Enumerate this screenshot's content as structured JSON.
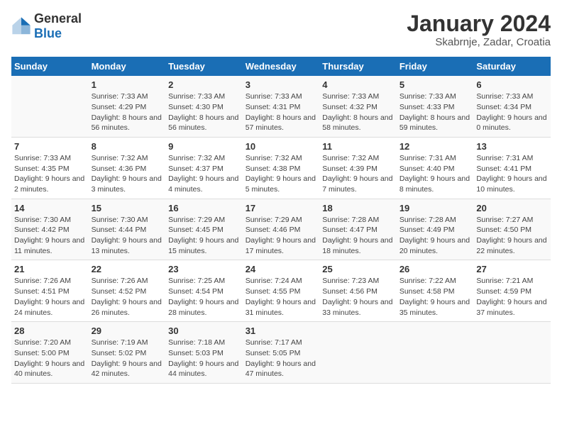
{
  "logo": {
    "general": "General",
    "blue": "Blue"
  },
  "title": "January 2024",
  "subtitle": "Skabrnje, Zadar, Croatia",
  "days_header": [
    "Sunday",
    "Monday",
    "Tuesday",
    "Wednesday",
    "Thursday",
    "Friday",
    "Saturday"
  ],
  "weeks": [
    [
      {
        "day": "",
        "sunrise": "",
        "sunset": "",
        "daylight": ""
      },
      {
        "day": "1",
        "sunrise": "Sunrise: 7:33 AM",
        "sunset": "Sunset: 4:29 PM",
        "daylight": "Daylight: 8 hours and 56 minutes."
      },
      {
        "day": "2",
        "sunrise": "Sunrise: 7:33 AM",
        "sunset": "Sunset: 4:30 PM",
        "daylight": "Daylight: 8 hours and 56 minutes."
      },
      {
        "day": "3",
        "sunrise": "Sunrise: 7:33 AM",
        "sunset": "Sunset: 4:31 PM",
        "daylight": "Daylight: 8 hours and 57 minutes."
      },
      {
        "day": "4",
        "sunrise": "Sunrise: 7:33 AM",
        "sunset": "Sunset: 4:32 PM",
        "daylight": "Daylight: 8 hours and 58 minutes."
      },
      {
        "day": "5",
        "sunrise": "Sunrise: 7:33 AM",
        "sunset": "Sunset: 4:33 PM",
        "daylight": "Daylight: 8 hours and 59 minutes."
      },
      {
        "day": "6",
        "sunrise": "Sunrise: 7:33 AM",
        "sunset": "Sunset: 4:34 PM",
        "daylight": "Daylight: 9 hours and 0 minutes."
      }
    ],
    [
      {
        "day": "7",
        "sunrise": "Sunrise: 7:33 AM",
        "sunset": "Sunset: 4:35 PM",
        "daylight": "Daylight: 9 hours and 2 minutes."
      },
      {
        "day": "8",
        "sunrise": "Sunrise: 7:32 AM",
        "sunset": "Sunset: 4:36 PM",
        "daylight": "Daylight: 9 hours and 3 minutes."
      },
      {
        "day": "9",
        "sunrise": "Sunrise: 7:32 AM",
        "sunset": "Sunset: 4:37 PM",
        "daylight": "Daylight: 9 hours and 4 minutes."
      },
      {
        "day": "10",
        "sunrise": "Sunrise: 7:32 AM",
        "sunset": "Sunset: 4:38 PM",
        "daylight": "Daylight: 9 hours and 5 minutes."
      },
      {
        "day": "11",
        "sunrise": "Sunrise: 7:32 AM",
        "sunset": "Sunset: 4:39 PM",
        "daylight": "Daylight: 9 hours and 7 minutes."
      },
      {
        "day": "12",
        "sunrise": "Sunrise: 7:31 AM",
        "sunset": "Sunset: 4:40 PM",
        "daylight": "Daylight: 9 hours and 8 minutes."
      },
      {
        "day": "13",
        "sunrise": "Sunrise: 7:31 AM",
        "sunset": "Sunset: 4:41 PM",
        "daylight": "Daylight: 9 hours and 10 minutes."
      }
    ],
    [
      {
        "day": "14",
        "sunrise": "Sunrise: 7:30 AM",
        "sunset": "Sunset: 4:42 PM",
        "daylight": "Daylight: 9 hours and 11 minutes."
      },
      {
        "day": "15",
        "sunrise": "Sunrise: 7:30 AM",
        "sunset": "Sunset: 4:44 PM",
        "daylight": "Daylight: 9 hours and 13 minutes."
      },
      {
        "day": "16",
        "sunrise": "Sunrise: 7:29 AM",
        "sunset": "Sunset: 4:45 PM",
        "daylight": "Daylight: 9 hours and 15 minutes."
      },
      {
        "day": "17",
        "sunrise": "Sunrise: 7:29 AM",
        "sunset": "Sunset: 4:46 PM",
        "daylight": "Daylight: 9 hours and 17 minutes."
      },
      {
        "day": "18",
        "sunrise": "Sunrise: 7:28 AM",
        "sunset": "Sunset: 4:47 PM",
        "daylight": "Daylight: 9 hours and 18 minutes."
      },
      {
        "day": "19",
        "sunrise": "Sunrise: 7:28 AM",
        "sunset": "Sunset: 4:49 PM",
        "daylight": "Daylight: 9 hours and 20 minutes."
      },
      {
        "day": "20",
        "sunrise": "Sunrise: 7:27 AM",
        "sunset": "Sunset: 4:50 PM",
        "daylight": "Daylight: 9 hours and 22 minutes."
      }
    ],
    [
      {
        "day": "21",
        "sunrise": "Sunrise: 7:26 AM",
        "sunset": "Sunset: 4:51 PM",
        "daylight": "Daylight: 9 hours and 24 minutes."
      },
      {
        "day": "22",
        "sunrise": "Sunrise: 7:26 AM",
        "sunset": "Sunset: 4:52 PM",
        "daylight": "Daylight: 9 hours and 26 minutes."
      },
      {
        "day": "23",
        "sunrise": "Sunrise: 7:25 AM",
        "sunset": "Sunset: 4:54 PM",
        "daylight": "Daylight: 9 hours and 28 minutes."
      },
      {
        "day": "24",
        "sunrise": "Sunrise: 7:24 AM",
        "sunset": "Sunset: 4:55 PM",
        "daylight": "Daylight: 9 hours and 31 minutes."
      },
      {
        "day": "25",
        "sunrise": "Sunrise: 7:23 AM",
        "sunset": "Sunset: 4:56 PM",
        "daylight": "Daylight: 9 hours and 33 minutes."
      },
      {
        "day": "26",
        "sunrise": "Sunrise: 7:22 AM",
        "sunset": "Sunset: 4:58 PM",
        "daylight": "Daylight: 9 hours and 35 minutes."
      },
      {
        "day": "27",
        "sunrise": "Sunrise: 7:21 AM",
        "sunset": "Sunset: 4:59 PM",
        "daylight": "Daylight: 9 hours and 37 minutes."
      }
    ],
    [
      {
        "day": "28",
        "sunrise": "Sunrise: 7:20 AM",
        "sunset": "Sunset: 5:00 PM",
        "daylight": "Daylight: 9 hours and 40 minutes."
      },
      {
        "day": "29",
        "sunrise": "Sunrise: 7:19 AM",
        "sunset": "Sunset: 5:02 PM",
        "daylight": "Daylight: 9 hours and 42 minutes."
      },
      {
        "day": "30",
        "sunrise": "Sunrise: 7:18 AM",
        "sunset": "Sunset: 5:03 PM",
        "daylight": "Daylight: 9 hours and 44 minutes."
      },
      {
        "day": "31",
        "sunrise": "Sunrise: 7:17 AM",
        "sunset": "Sunset: 5:05 PM",
        "daylight": "Daylight: 9 hours and 47 minutes."
      },
      {
        "day": "",
        "sunrise": "",
        "sunset": "",
        "daylight": ""
      },
      {
        "day": "",
        "sunrise": "",
        "sunset": "",
        "daylight": ""
      },
      {
        "day": "",
        "sunrise": "",
        "sunset": "",
        "daylight": ""
      }
    ]
  ]
}
